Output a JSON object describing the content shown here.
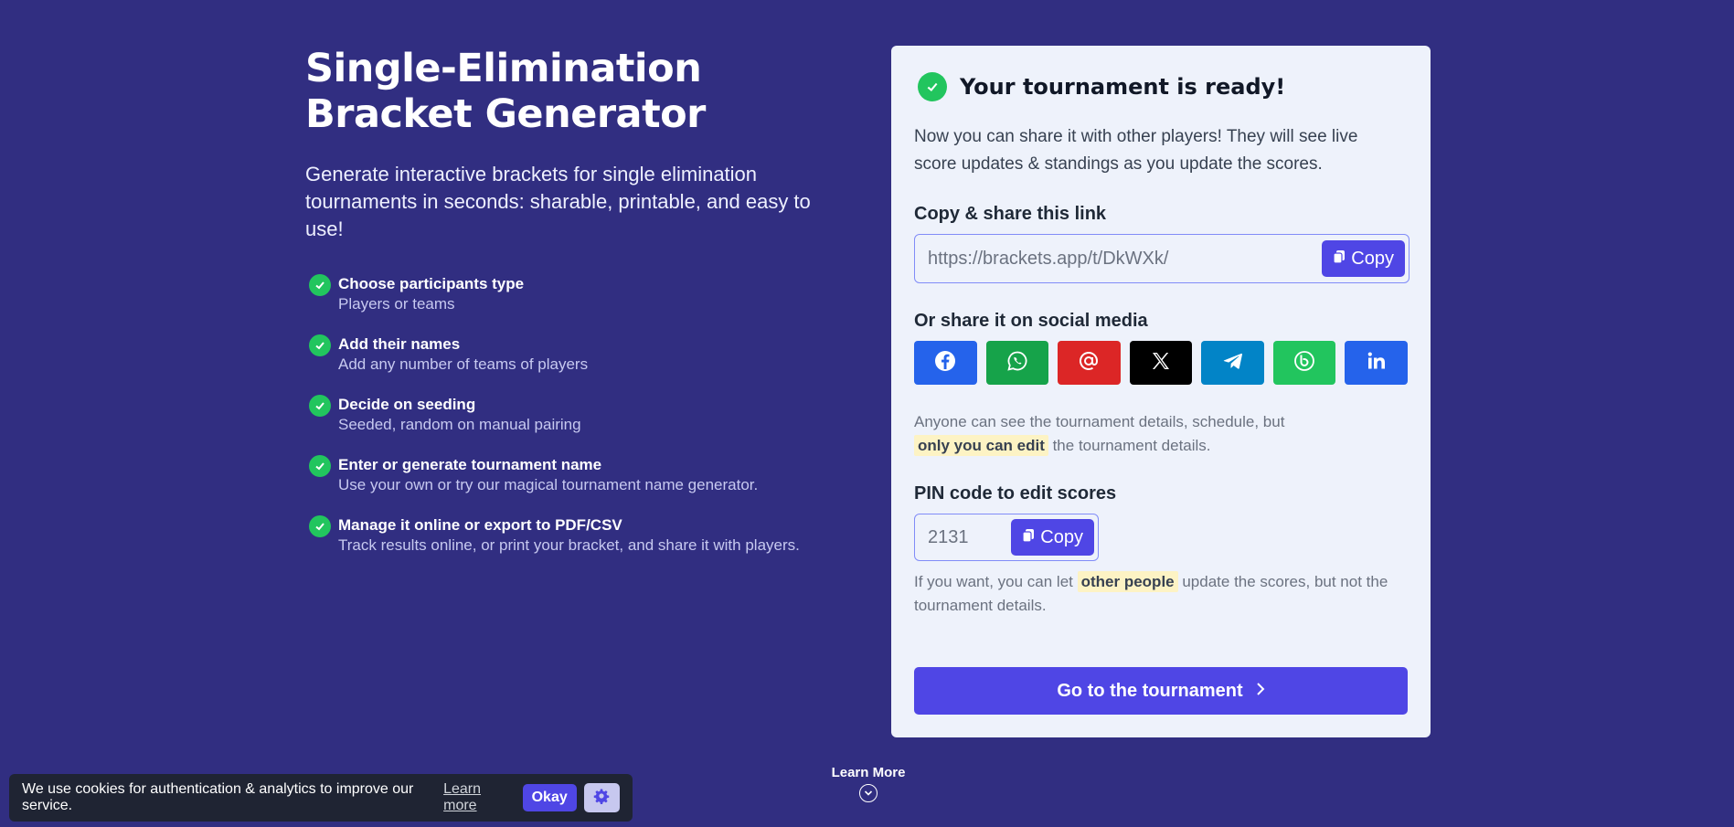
{
  "hero": {
    "title": "Single-Elimination Bracket Generator",
    "subtitle": "Generate interactive brackets for single elimination tournaments in seconds: sharable, printable, and easy to use!"
  },
  "features": [
    {
      "title": "Choose participants type",
      "desc": "Players or teams"
    },
    {
      "title": "Add their names",
      "desc": "Add any number of teams of players"
    },
    {
      "title": "Decide on seeding",
      "desc": "Seeded, random on manual pairing"
    },
    {
      "title": "Enter or generate tournament name",
      "desc": "Use your own or try our magical tournament name generator."
    },
    {
      "title": "Manage it online or export to PDF/CSV",
      "desc": "Track results online, or print your bracket, and share it with players."
    }
  ],
  "card": {
    "ready_title": "Your tournament is ready!",
    "ready_text": "Now you can share it with other players! They will see live score updates & standings as you update the scores.",
    "link_label": "Copy & share this link",
    "link_value": "https://brackets.app/t/DkWXk/",
    "copy_label": "Copy",
    "social_label": "Or share it on social media",
    "socials": [
      {
        "name": "facebook",
        "color": "#2563eb"
      },
      {
        "name": "whatsapp",
        "color": "#16a34a"
      },
      {
        "name": "email",
        "color": "#dc2626"
      },
      {
        "name": "x",
        "color": "#000000"
      },
      {
        "name": "telegram",
        "color": "#0284c7"
      },
      {
        "name": "bip",
        "color": "#22c55e"
      },
      {
        "name": "linkedin",
        "color": "#2563eb"
      }
    ],
    "note1_pre": "Anyone can see the tournament details, schedule, but",
    "note1_hl": "only you can edit",
    "note1_post": " the tournament details.",
    "pin_label": "PIN code to edit scores",
    "pin_value": "2131",
    "pin_copy_label": "Copy",
    "note2_pre": "If you want, you can let ",
    "note2_hl": "other people",
    "note2_post": " update the scores, but not the tournament details.",
    "go_label": "Go to the tournament"
  },
  "learn_more": "Learn More",
  "cookie": {
    "text": "We use cookies for authentication & analytics to improve our service.",
    "learn": "Learn more",
    "okay": "Okay"
  },
  "colors": {
    "background": "#312e81",
    "accent": "#4f46e5",
    "success": "#22c55e"
  }
}
